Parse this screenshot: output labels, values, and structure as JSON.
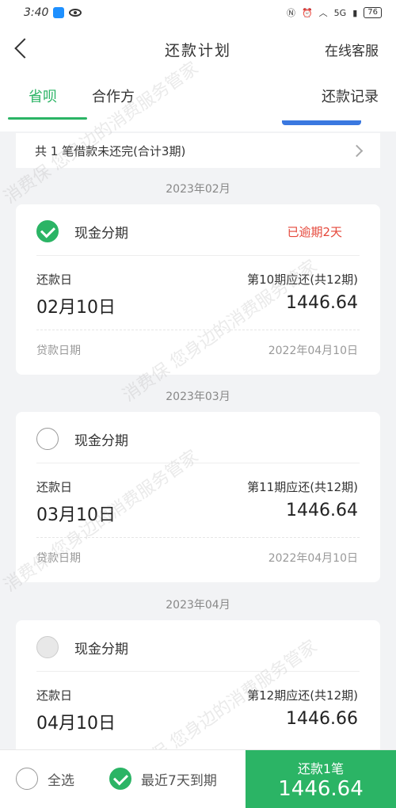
{
  "status_bar": {
    "time": "3:40",
    "network": "5G",
    "battery": "76"
  },
  "header": {
    "title": "还款计划",
    "service_label": "在线客服"
  },
  "tabs": {
    "items": [
      {
        "label": "省呗",
        "active": true
      },
      {
        "label": "合作方",
        "active": false
      }
    ],
    "record_label": "还款记录"
  },
  "summary": {
    "text": "共 1 笔借款未还完(合计3期)"
  },
  "months": [
    "2023年02月",
    "2023年03月",
    "2023年04月"
  ],
  "cards": [
    {
      "type": "现金分期",
      "status": "已逾期2天",
      "due_label": "还款日",
      "due_date": "02月10日",
      "period_label": "第10期应还(共12期)",
      "amount": "1446.64",
      "loan_date_label": "贷款日期",
      "loan_date": "2022年04月10日",
      "checked": true
    },
    {
      "type": "现金分期",
      "status": "",
      "due_label": "还款日",
      "due_date": "03月10日",
      "period_label": "第11期应还(共12期)",
      "amount": "1446.64",
      "loan_date_label": "贷款日期",
      "loan_date": "2022年04月10日",
      "checked": false
    },
    {
      "type": "现金分期",
      "status": "",
      "due_label": "还款日",
      "due_date": "04月10日",
      "period_label": "第12期应还(共12期)",
      "amount": "1446.66",
      "loan_date_label": "",
      "loan_date": "",
      "checked": false
    }
  ],
  "bottom_bar": {
    "select_all_label": "全选",
    "recent_label": "最近7天到期",
    "pay_label": "还款1笔",
    "pay_amount": "1446.64"
  },
  "watermark": {
    "line1": "消费保 您身边的消费服务管家"
  },
  "colors": {
    "accent": "#2bb465",
    "overdue": "#e5473a"
  }
}
